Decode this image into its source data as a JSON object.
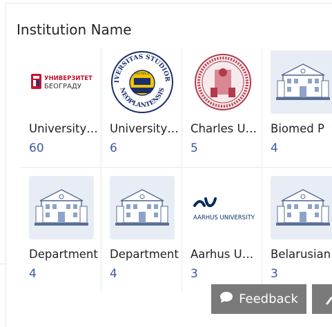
{
  "section": {
    "title": "Institution Name"
  },
  "institutions": [
    {
      "name": "University of Belgrade",
      "count": "60",
      "logo": "belgrade-logo",
      "logo_text_top": "УНИВЕРЗИТЕТ",
      "logo_text_bottom": "БЕОГРАДУ"
    },
    {
      "name": "University of Novi Sad",
      "count": "6",
      "logo": "novi-sad-seal",
      "seal_top": "UNIVERSITAS STUDIORUM",
      "seal_bottom": "NEOPLANTENSIS",
      "seal_year": "MCMLX"
    },
    {
      "name": "Charles University",
      "count": "5",
      "logo": "charles-seal"
    },
    {
      "name": "Biomed P",
      "count": "4",
      "logo": "building-placeholder-icon"
    },
    {
      "name": "Department",
      "count": "4",
      "logo": "building-placeholder-icon"
    },
    {
      "name": "Department",
      "count": "4",
      "logo": "building-placeholder-icon"
    },
    {
      "name": "Aarhus University",
      "count": "3",
      "logo": "aarhus-logo",
      "logo_text": "AARHUS UNIVERSITY"
    },
    {
      "name": "Belarusian",
      "count": "3",
      "logo": "building-placeholder-icon"
    }
  ],
  "feedback": {
    "label": "Feedback"
  },
  "colors": {
    "count": "#3a5aa6",
    "button_bg": "#7a7a7a",
    "placeholder_bg": "#e8edf5",
    "belgrade_red": "#c8102e",
    "aarhus_navy": "#002b5c",
    "charles_red": "#b33a4a"
  }
}
